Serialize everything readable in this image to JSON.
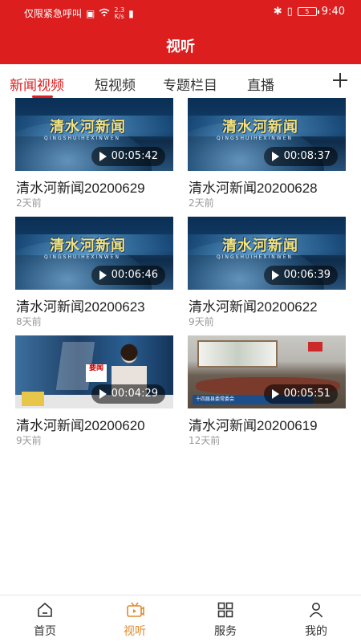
{
  "status_bar": {
    "carrier": "仅限紧急呼叫",
    "net_speed_value": "2.3",
    "net_speed_unit": "K/s",
    "battery": "5",
    "time": "9:40"
  },
  "header": {
    "title": "视听"
  },
  "tabs": [
    {
      "label": "新闻视频",
      "active": true
    },
    {
      "label": "短视频",
      "active": false
    },
    {
      "label": "专题栏目",
      "active": false
    },
    {
      "label": "直播",
      "active": false
    }
  ],
  "tab_add_icon": "plus-icon",
  "videos": [
    {
      "title": "清水河新闻20200629",
      "time": "2天前",
      "duration": "00:05:42",
      "thumbnail": "news-logo"
    },
    {
      "title": "清水河新闻20200628",
      "time": "2天前",
      "duration": "00:08:37",
      "thumbnail": "news-logo"
    },
    {
      "title": "清水河新闻20200623",
      "time": "8天前",
      "duration": "00:06:46",
      "thumbnail": "news-logo"
    },
    {
      "title": "清水河新闻20200622",
      "time": "9天前",
      "duration": "00:06:39",
      "thumbnail": "news-logo"
    },
    {
      "title": "清水河新闻20200620",
      "time": "9天前",
      "duration": "00:04:29",
      "thumbnail": "news-anchor"
    },
    {
      "title": "清水河新闻20200619",
      "time": "12天前",
      "duration": "00:05:51",
      "thumbnail": "meeting"
    }
  ],
  "thumb_text": {
    "logo": "清水河新闻",
    "logo_sub": "QINGSHUIHEXINWEN",
    "anchor_tag": "要闻",
    "meeting_caption": "十四届县委常委会"
  },
  "bottom_nav": [
    {
      "label": "首页",
      "icon": "home-icon",
      "active": false
    },
    {
      "label": "视听",
      "icon": "video-icon",
      "active": true
    },
    {
      "label": "服务",
      "icon": "grid-icon",
      "active": false
    },
    {
      "label": "我的",
      "icon": "user-icon",
      "active": false
    }
  ],
  "colors": {
    "brand_red": "#dc1e1e",
    "active_nav": "#e08a2c"
  }
}
